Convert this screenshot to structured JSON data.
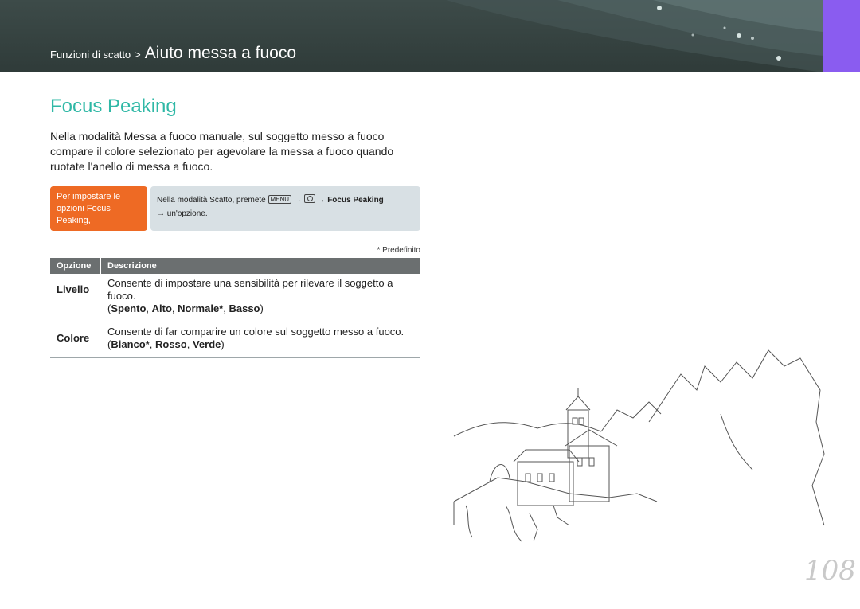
{
  "header": {
    "breadcrumb_parent": "Funzioni di scatto",
    "breadcrumb_separator": ">",
    "breadcrumb_current": "Aiuto messa a fuoco",
    "background_color": "#34413f",
    "side_tab_color": "#8a5cf0"
  },
  "section": {
    "title": "Focus Peaking",
    "title_color": "#2fb8a6",
    "intro": "Nella modalità Messa a fuoco manuale, sul soggetto messo a fuoco compare il colore selezionato per agevolare la messa a fuoco quando ruotate l'anello di messa a fuoco."
  },
  "howto": {
    "label": "Per impostare le opzioni Focus Peaking,",
    "label_color": "#ee6a24",
    "text_before": "Nella modalità Scatto, premete",
    "menu_key": "MENU",
    "arrow": "→",
    "camera_icon": "camera-icon",
    "target": "Focus Peaking",
    "text_after": "un'opzione."
  },
  "footnote": "* Predefinito",
  "table": {
    "headers": [
      "Opzione",
      "Descrizione"
    ],
    "rows": [
      {
        "name": "Livello",
        "description": "Consente di impostare una sensibilità per rilevare il soggetto a fuoco.",
        "values": [
          "Spento",
          "Alto",
          "Normale*",
          "Basso"
        ]
      },
      {
        "name": "Colore",
        "description": "Consente di far comparire un colore sul soggetto messo a fuoco.",
        "values": [
          "Bianco*",
          "Rosso",
          "Verde"
        ]
      }
    ]
  },
  "page_number": "108"
}
